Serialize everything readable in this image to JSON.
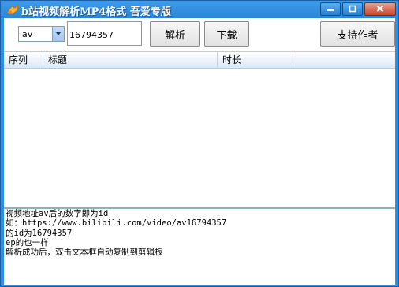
{
  "window": {
    "title": "b站视频解析MP4格式 吾爱专版",
    "icon": "app-logo-icon",
    "controls": [
      "minimize-icon",
      "maximize-icon",
      "close-icon"
    ],
    "colors": {
      "titlebar": "#2f8fde",
      "close": "#c8452c"
    }
  },
  "toolbar": {
    "type_select": {
      "value": "av",
      "options_visible": [
        "av"
      ]
    },
    "id_input": {
      "value": "16794357"
    },
    "parse_label": "解析",
    "download_label": "下载",
    "support_label": "支持作者"
  },
  "list": {
    "columns": [
      "序列",
      "标题",
      "时长",
      ""
    ],
    "rows": []
  },
  "log": {
    "lines": [
      "视频地址av后的数字即为id",
      "如：https://www.bilibili.com/video/av16794357",
      "的id为16794357",
      "ep的也一样",
      "解析成功后，双击文本框自动复制到剪辑板"
    ]
  }
}
